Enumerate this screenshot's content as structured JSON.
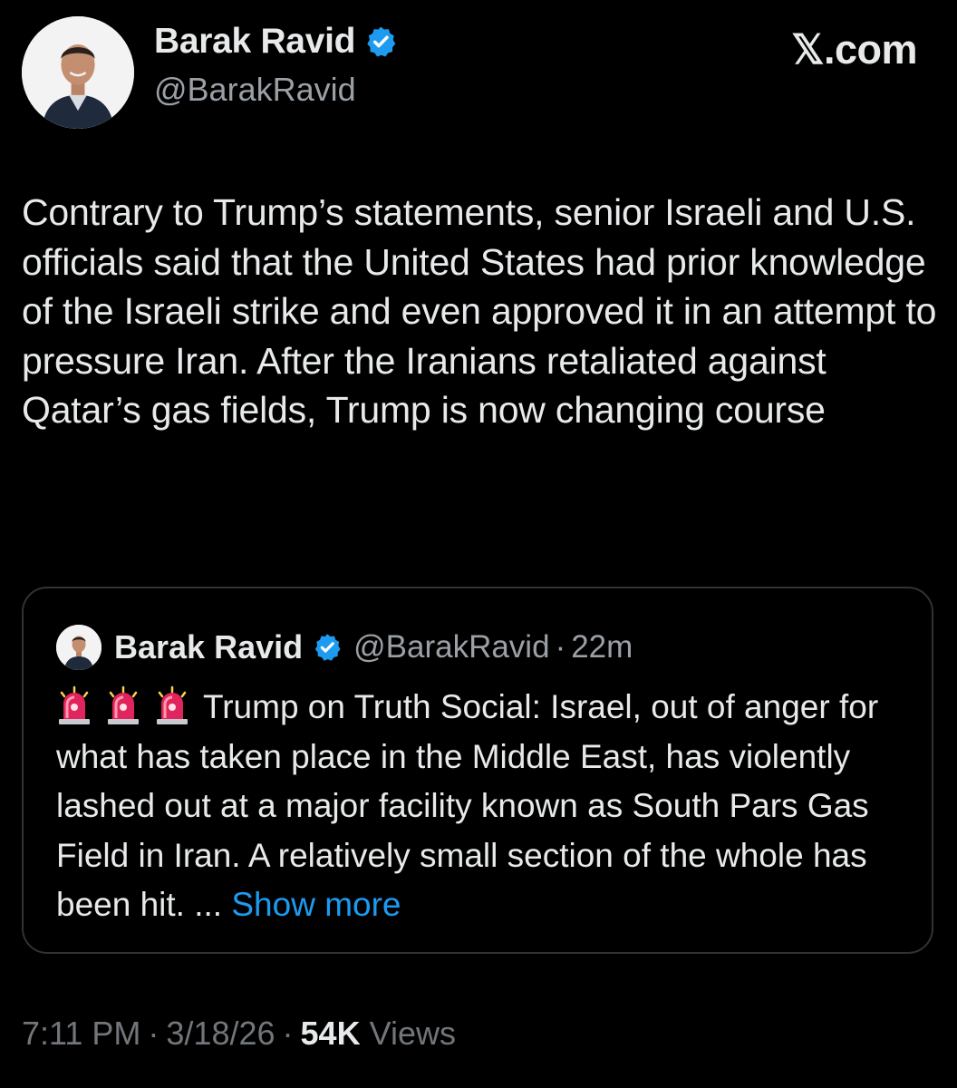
{
  "author": {
    "display_name": "Barak Ravid",
    "handle": "@BarakRavid",
    "verified_color": "#1d9bf0"
  },
  "brand": "𝕏.com",
  "tweet": {
    "text": "Contrary to Trump’s statements, senior Israeli and U.S. officials said that the United States had prior knowledge of the Israeli strike and even approved it in an attempt to pressure Iran. After the Iranians retaliated against Qatar’s gas fields, Trump is now changing course"
  },
  "quoted_tweet": {
    "display_name": "Barak Ravid",
    "handle": "@BarakRavid",
    "separator": "·",
    "time_ago": "22m",
    "emoji": [
      "siren-icon",
      "siren-icon",
      "siren-icon"
    ],
    "text": "Trump on Truth Social: Israel, out of anger for what has taken place in the Middle East, has violently lashed out at a major facility known as South Pars Gas Field in Iran. A relatively small section of the whole has been hit. ...",
    "show_more_label": "Show more",
    "link_color": "#1d9bf0"
  },
  "meta": {
    "time": "7:11 PM",
    "separator": "·",
    "date": "3/18/26",
    "views_count": "54K",
    "views_label": "Views"
  }
}
